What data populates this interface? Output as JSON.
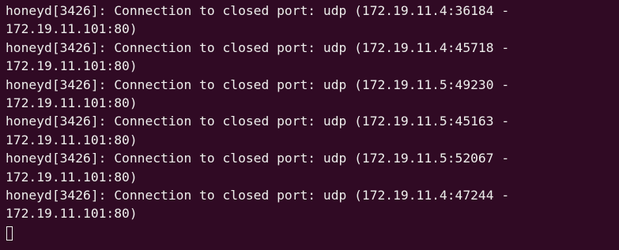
{
  "terminal": {
    "lines": [
      "honeyd[3426]: Connection to closed port: udp (172.19.11.4:36184 -",
      "172.19.11.101:80)",
      "honeyd[3426]: Connection to closed port: udp (172.19.11.4:45718 -",
      "172.19.11.101:80)",
      "honeyd[3426]: Connection to closed port: udp (172.19.11.5:49230 -",
      "172.19.11.101:80)",
      "honeyd[3426]: Connection to closed port: udp (172.19.11.5:45163 -",
      "172.19.11.101:80)",
      "honeyd[3426]: Connection to closed port: udp (172.19.11.5:52067 -",
      "172.19.11.101:80)",
      "honeyd[3426]: Connection to closed port: udp (172.19.11.4:47244 -",
      "172.19.11.101:80)"
    ],
    "colors": {
      "background": "#300a24",
      "foreground": "#eeeeec"
    }
  }
}
